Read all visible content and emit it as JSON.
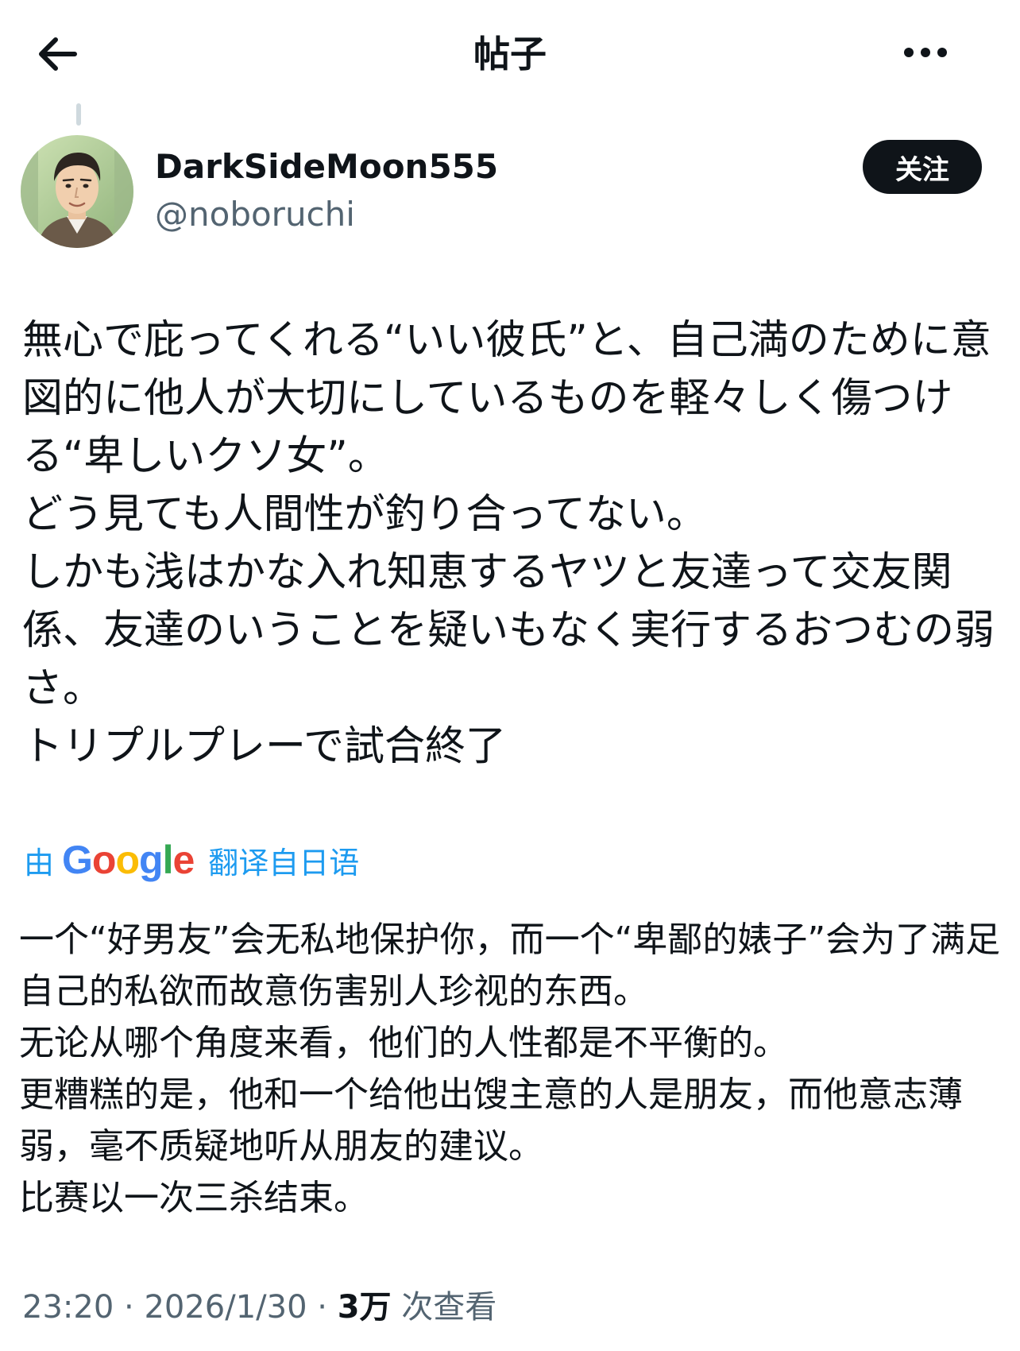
{
  "header": {
    "title": "帖子",
    "back_icon": "arrow-left-icon",
    "more_icon": "more-horizontal-icon"
  },
  "author": {
    "display_name": "DarkSideMoon555",
    "handle": "@noboruchi",
    "follow_label": "关注"
  },
  "post": {
    "text": "無心で庇ってくれる“いい彼氏”と、自己満のために意図的に他人が大切にしているものを軽々しく傷つける“卑しいクソ女”。\nどう見ても人間性が釣り合ってない。\nしかも浅はかな入れ知恵するヤツと友達って交友関係、友達のいうことを疑いもなく実行するおつむの弱さ。\nトリプルプレーで試合終了"
  },
  "translation": {
    "prefix": "由",
    "provider": "Google",
    "suffix": "翻译自日语",
    "text": "一个“好男友”会无私地保护你，而一个“卑鄙的婊子”会为了满足自己的私欲而故意伤害别人珍视的东西。\n无论从哪个角度来看，他们的人性都是不平衡的。\n更糟糕的是，他和一个给他出馊主意的人是朋友，而他意志薄弱，毫不质疑地听从朋友的建议。\n比赛以一次三杀结束。"
  },
  "meta": {
    "time": "23:20",
    "date": "2026/1/30",
    "separator": "·",
    "views_count": "3万",
    "views_label": "次查看"
  },
  "colors": {
    "text": "#0f1419",
    "secondary": "#536471",
    "link": "#1d9bf0",
    "button_bg": "#0f1419"
  }
}
